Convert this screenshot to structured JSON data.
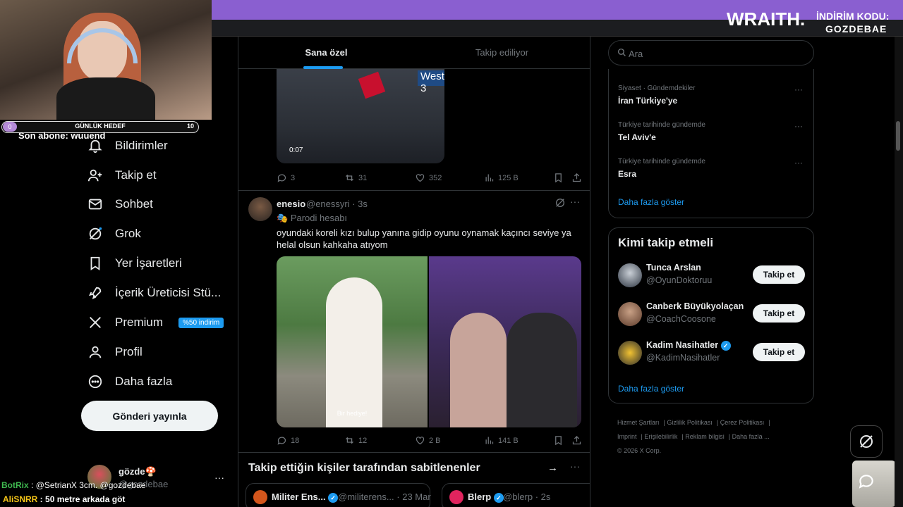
{
  "feed": {
    "tabs": [
      "Sana özel",
      "Takip ediliyor"
    ],
    "video_tweet": {
      "sign_text": "West 3",
      "time": "0:07",
      "replies": "3",
      "reposts": "31",
      "likes": "352",
      "views": "125 B"
    },
    "tweet": {
      "name": "enesio",
      "handle_time": "@enessyri · 3s",
      "parody_label": "Parodi hesabı",
      "text": "oyundaki koreli kızı bulup yanına gidip oyunu oynamak kaçıncı seviye ya helal olsun kahkaha atıyom",
      "media_caption": "Bir hediye!",
      "replies": "18",
      "reposts": "12",
      "likes": "2 B",
      "views": "141 B"
    },
    "pinned": {
      "title": "Takip ettiğin kişiler tarafından sabitlenenler",
      "cards": [
        {
          "name": "Militer Ens...",
          "handle": "@militerens... · 23 Mar"
        },
        {
          "name": "Blerp",
          "handle": "@blerp · 2s"
        }
      ]
    }
  },
  "nav": {
    "items": [
      {
        "label": "Bildirimler",
        "icon": "bell-icon"
      },
      {
        "label": "Takip et",
        "icon": "person-plus-icon"
      },
      {
        "label": "Sohbet",
        "icon": "envelope-icon"
      },
      {
        "label": "Grok",
        "icon": "grok-icon"
      },
      {
        "label": "Yer İşaretleri",
        "icon": "bookmark-icon"
      },
      {
        "label": "İçerik Üreticisi Stü...",
        "icon": "rocket-icon"
      },
      {
        "label": "Premium",
        "icon": "x-logo-icon"
      },
      {
        "label": "Profil",
        "icon": "person-icon"
      },
      {
        "label": "Daha fazla",
        "icon": "more-circle-icon"
      }
    ],
    "premium_badge": "%50 indirim",
    "post_button": "Gönderi yayınla",
    "account": {
      "name": "gözde🍄",
      "handle": "@gozdebae"
    }
  },
  "sidebar": {
    "search_placeholder": "Ara",
    "trends": [
      {
        "context": "Siyaset · Gündemdekiler",
        "title": "İran Türkiye'ye"
      },
      {
        "context": "Türkiye tarihinde gündemde",
        "title": "Tel Aviv'e"
      },
      {
        "context": "Türkiye tarihinde gündemde",
        "title": "Esra"
      }
    ],
    "show_more": "Daha fazla göster",
    "who_to_follow": {
      "title": "Kimi takip etmeli",
      "users": [
        {
          "name": "Tunca Arslan",
          "handle": "@OyunDoktoruu",
          "verified": false
        },
        {
          "name": "Canberk Büyükyolaçan",
          "handle": "@CoachCoosone",
          "verified": false
        },
        {
          "name": "Kadim Nasihatler",
          "handle": "@KadimNasihatler",
          "verified": true
        }
      ],
      "follow_label": "Takip et",
      "show_more": "Daha fazla göster"
    },
    "footer": [
      "Hizmet Şartları",
      "Gizlilik Politikası",
      "Çerez Politikası",
      "Imprint",
      "Erişilebilirlik",
      "Reklam bilgisi",
      "Daha fazla ...",
      "© 2026 X Corp."
    ]
  },
  "overlay": {
    "goal_label": "GÜNLÜK HEDEF",
    "goal_current": "0",
    "goal_target": "10",
    "last_sub": "Son abone: wuuend",
    "brand": "WRAITH.",
    "code_label": "İNDİRİM KODU:",
    "code_value": "GOZDEBAE",
    "chat": [
      {
        "user": "BotRix",
        "message": "@SetrianX 3cm. @gozdebae"
      },
      {
        "user": "AliSNRR",
        "message": "50 metre arkada göt"
      }
    ]
  },
  "colors": {
    "accent": "#1d9bf0",
    "overlay_purple": "#8a5fd0",
    "background": "#000000"
  }
}
